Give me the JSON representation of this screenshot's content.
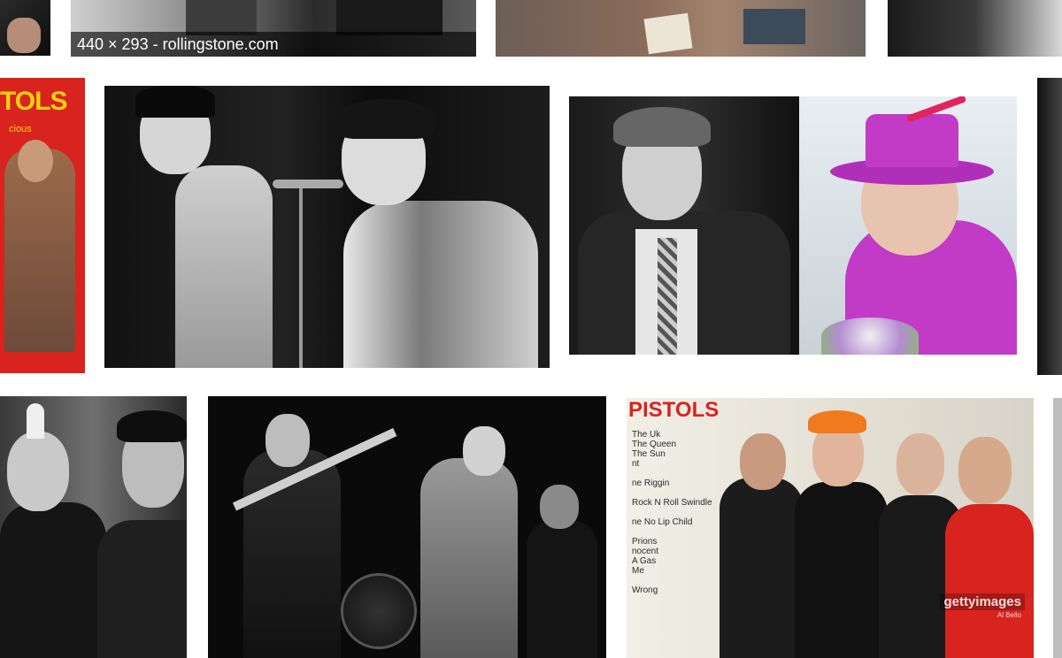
{
  "grid": {
    "tiles": [
      {
        "id": "top-left-partial"
      },
      {
        "id": "top-rollingstone",
        "caption": "440 × 293 - rollingstone.com"
      },
      {
        "id": "top-center"
      },
      {
        "id": "top-right-partial"
      },
      {
        "id": "poster-left-partial",
        "poster_text": "TOLS",
        "poster_sub": "cious"
      },
      {
        "id": "stage-duo-bw"
      },
      {
        "id": "split-singer-and-queen"
      },
      {
        "id": "right-edge-partial"
      },
      {
        "id": "mohawk-crowd-bw"
      },
      {
        "id": "band-on-stage-bw"
      },
      {
        "id": "band-reunion-poster",
        "poster_title": "PISTOLS",
        "tracklist": [
          "The Uk",
          "The Queen",
          "The Sun",
          "nt",
          "",
          "ne Riggin",
          "",
          "Rock N Roll Swindle",
          "",
          "ne No Lip Child",
          "",
          "Prions",
          "nocent",
          "A Gas",
          "Me",
          "",
          "Wrong"
        ],
        "watermark": "gettyimages",
        "watermark_sub": "Al Bello"
      },
      {
        "id": "far-right-edge"
      }
    ]
  },
  "colors": {
    "caption_bg": "#000000",
    "poster_red": "#d8231f",
    "queen_magenta": "#c13bc6"
  }
}
